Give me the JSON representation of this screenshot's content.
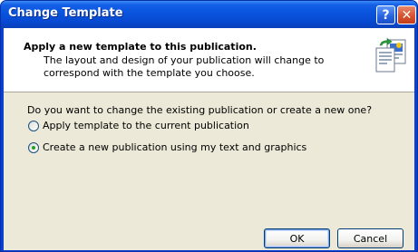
{
  "window": {
    "title": "Change Template",
    "help_glyph": "?",
    "close_glyph": "✕"
  },
  "header": {
    "title": "Apply a new template to this publication.",
    "description": "The layout and design of your publication will change to correspond with the template you choose.",
    "icon": "template-document-icon"
  },
  "body": {
    "question": "Do you want to change the existing publication or create a new one?",
    "options": [
      {
        "label": "Apply template to the current publication",
        "selected": false
      },
      {
        "label": "Create a new publication using my text and graphics",
        "selected": true
      }
    ]
  },
  "buttons": {
    "ok_label": "OK",
    "cancel_label": "Cancel"
  },
  "colors": {
    "titlebar": "#0a55df",
    "dialog_bg": "#ece9d8",
    "header_bg": "#ffffff",
    "radio_dot": "#21a121",
    "close_button": "#d9532e"
  }
}
